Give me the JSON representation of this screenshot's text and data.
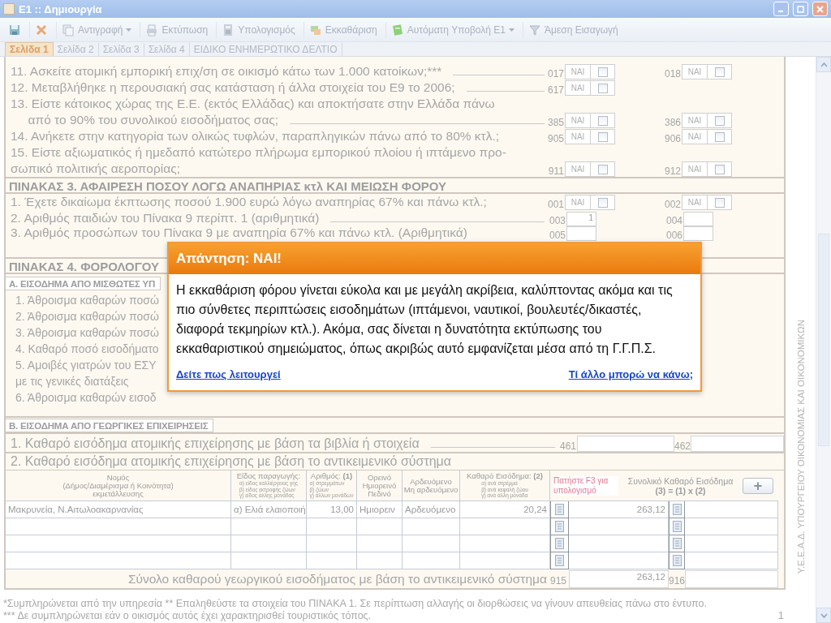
{
  "window": {
    "title": "Ε1 :: Δημιουργία"
  },
  "toolbar": [
    {
      "kind": "save"
    },
    {
      "kind": "delete"
    },
    {
      "kind": "copy",
      "label": "Αντιγραφή",
      "dropdown": true
    },
    {
      "kind": "print",
      "label": "Εκτύπωση",
      "dropdown": false
    },
    {
      "kind": "calc",
      "label": "Υπολογισμός",
      "dropdown": false
    },
    {
      "kind": "clear",
      "label": "Εκκαθάριση",
      "dropdown": false
    },
    {
      "kind": "submit",
      "label": "Αυτόματη Υποβολή Ε1",
      "dropdown": true
    },
    {
      "kind": "import",
      "label": "Άμεση Εισαγωγή",
      "dropdown": false
    }
  ],
  "tabs": [
    {
      "label": "Σελίδα 1",
      "selected": true
    },
    {
      "label": "Σελίδα 2",
      "selected": false
    },
    {
      "label": "Σελίδα 3",
      "selected": false
    },
    {
      "label": "Σελίδα 4",
      "selected": false
    },
    {
      "label": "ΕΙΔΙΚΟ ΕΝΗΜΕΡΩΤΙΚΟ ΔΕΛΤΙΟ",
      "selected": false
    }
  ],
  "questions": [
    {
      "lines": [
        "11. Ασκείτε ατομική εμπορική επιχ/ση σε οικισμό κάτω των 1.000 κατοίκων;***"
      ],
      "leader": true,
      "fields": [
        {
          "kind": "yes",
          "code": "017",
          "label": "ΝΑΙ",
          "checked": false
        },
        {
          "kind": "yes",
          "code": "018",
          "label": "ΝΑΙ",
          "checked": false
        }
      ]
    },
    {
      "lines": [
        "12. Μεταβλήθηκε η περουσιακή σας κατάσταση ή άλλα στοιχεία του Ε9 το 2006;"
      ],
      "leader": true,
      "fields": [
        {
          "kind": "yes",
          "code": "617",
          "label": "ΝΑΙ",
          "checked": false
        }
      ]
    },
    {
      "lines": [
        "13. Είστε κάτοικος χώρας της Ε.Ε. (εκτός Ελλάδας) και αποκτήσατε στην Ελλάδα πάνω",
        "     από το 90% του συνολικού εισοδήματος σας;"
      ],
      "leader": true,
      "fields": [
        {
          "kind": "yes",
          "code": "385",
          "label": "ΝΑΙ",
          "checked": false
        },
        {
          "kind": "yes",
          "code": "386",
          "label": "ΝΑΙ",
          "checked": false
        }
      ]
    },
    {
      "lines": [
        "14. Ανήκετε στην κατηγορία των ολικώς τυφλών, παραπληγικών πάνω από το 80% κτλ.;"
      ],
      "leader": false,
      "fields": [
        {
          "kind": "yes",
          "code": "905",
          "label": "ΝΑΙ",
          "checked": false
        },
        {
          "kind": "yes",
          "code": "906",
          "label": "ΝΑΙ",
          "checked": false
        }
      ]
    },
    {
      "lines": [
        "15. Είστε αξιωματικός ή ημεδαπό κατώτερο πλήρωμα εμπορικού πλοίου ή ιπτάμενο προ-",
        "σωπικό πολιτικής αεροπορίας;"
      ],
      "leader": false,
      "fields": [
        {
          "kind": "yes",
          "code": "911",
          "label": "ΝΑΙ",
          "checked": false
        },
        {
          "kind": "yes",
          "code": "912",
          "label": "ΝΑΙ",
          "checked": false
        }
      ]
    }
  ],
  "table3": {
    "title": "ΠΙΝΑΚΑΣ 3. ΑΦΑΙΡΕΣΗ ΠΟΣΟΥ ΛΟΓΩ ΑΝΑΠΗΡΙΑΣ κτλ ΚΑΙ ΜΕΙΩΣΗ ΦΟΡΟΥ",
    "questions": [
      {
        "lines": [
          "1. Έχετε δικαίωμα έκπτωσης ποσού 1.900 ευρώ λόγω αναπηρίας 67% και πάνω κτλ.;"
        ],
        "leader": false,
        "fields": [
          {
            "kind": "yes",
            "code": "001",
            "label": "ΝΑΙ",
            "checked": false
          },
          {
            "kind": "yes",
            "code": "002",
            "label": "ΝΑΙ",
            "checked": false
          }
        ]
      },
      {
        "lines": [
          "2. Αριθμός παιδιών του Πίνακα 9 περίπτ. 1 (αριθμητικά)"
        ],
        "leader": true,
        "fields": [
          {
            "kind": "number",
            "code": "003",
            "value": "1"
          },
          {
            "kind": "number",
            "code": "004"
          }
        ]
      },
      {
        "lines": [
          "3. Αριθμός προσώπων του Πίνακα 9 με αναπηρία 67% και πάνω κτλ. (Αριθμητικά)"
        ],
        "leader": false,
        "fields": [
          {
            "kind": "number",
            "code": "005"
          },
          {
            "kind": "number",
            "code": "006"
          }
        ]
      }
    ]
  },
  "table4": {
    "title": "ΠΙΝΑΚΑΣ 4. ΦΟΡΟΛΟΓΟΥ",
    "section": "Α. ΕΙΣΟΔΗΜΑ ΑΠΟ ΜΙΣΘΩΤΕΣ ΥΠ",
    "items": [
      {
        "lines": [
          "1. Άθροισμα καθαρών ποσώ"
        ]
      },
      {
        "lines": [
          "2. Άθροισμα καθαρών ποσώ"
        ]
      },
      {
        "lines": [
          "3. Άθροισμα καθαρών ποσώ"
        ]
      },
      {
        "lines": [
          "4. Καθαρό ποσό εισοδήματο"
        ]
      },
      {
        "lines": [
          "5. Αμοιβές γιατρών του ΕΣΥ",
          "με τις γενικές διατάξεις"
        ]
      },
      {
        "lines": [
          "6. Άθροισμα καθαρών εισοδ"
        ]
      }
    ]
  },
  "sectionB": {
    "title": "Β. ΕΙΣΟΔΗΜΑ ΑΠΟ ΓΕΩΡΓΙΚΕΣ ΕΠΙΧΕΙΡΗΣΕΙΣ",
    "row1": {
      "text": "1. Καθαρό εισόδημα ατομικής επιχείρησης με βάση τα βιβλία ή στοιχεία",
      "codes": [
        "461",
        "462"
      ]
    },
    "row2": {
      "text": "2. Καθαρό εισόδημα ατομικής επιχείρησης με βάση το αντικειμενικό σύστημα"
    }
  },
  "farm_table": {
    "columns": [
      {
        "title": "Νομός\n(Δήμος/Διαμέρισμα ή Κοινότητα)\nεκμετάλλευσης"
      },
      {
        "title": "Είδος παραγωγής:",
        "sub": "α) είδος καλλιέργειας γης\nβ) είδος εκτροφής ζώων\nγ) είδος άλλης μονάδας"
      },
      {
        "title": "Αριθμός: **(1)**",
        "sub": "α) στρεμμάτων\nβ) ζώων\nγ) άλλων μονάδων"
      },
      {
        "title": "Ορεινό\nΗμιορεινό\nΠεδινό"
      },
      {
        "title": "Αρδευόμενο\nΜη αρδευόμενο"
      },
      {
        "title": "Καθαρό Εισόδημα: **(2)**",
        "sub": "α) ανά στρέμμα\nβ) ανά κεφαλή ζώου\nγ) ανά άλλη μονάδα"
      }
    ],
    "hint": "Πατήστε F3 για υπολογισμό",
    "total_header": "Συνολικό  Καθαρό Εισόδημα",
    "formula": "(3) = (1) x (2)",
    "add_button": "+",
    "rows": [
      {
        "cells": [
          "Μακρυνεία, Ν.Αιτωλοακαρνανίας",
          "α) Ελιά ελαιοποιή",
          "13,00",
          "Ημιορειν",
          "Αρδευόμενο",
          "20,24"
        ],
        "total": "263,12"
      }
    ],
    "sum": {
      "label": "Σύνολο καθαρού γεωργικού εισοδήματος με βάση το αντικειμενικό σύστημα",
      "code": "915",
      "value": "263,12",
      "code2": "916"
    }
  },
  "footnotes": [
    "*Συμπληρώνεται από την υπηρεσία  ** Επαληθεύστε τα στοιχεία του ΠΙΝΑΚΑ 1. Σε περίπτωση αλλαγής οι διορθώσεις να γίνουν απευθείας πάνω στο έντυπο.",
    "*** Δε συμπληρώνεται εάν ο οικισμός αυτός έχει χαρακτηρισθεί τουριστικός τόπος."
  ],
  "page_number": "1",
  "side_text": "Υ.Ε.Ε.Α.Δ. ΥΠΟΥΡΓΕΙΟΥ ΟΙΚΟΝΟΜΙΑΣ ΚΑΙ ΟΙΚΟΝΟΜΙΚΩΝ",
  "popup": {
    "title": "Απάντηση: ΝΑΙ!",
    "body": "Η εκκαθάριση φόρου γίνεται εύκολα και με μεγάλη ακρίβεια, καλύπτοντας ακόμα και τις πιο σύνθετες περιπτώσεις εισοδημάτων (ιπτάμενοι, ναυτικοί, βουλευτές/δικαστές, διαφορά τεκμηρίων κτλ.). Ακόμα, σας δίνεται η δυνατότητα εκτύπωσης του εκκαθαριστικού σημειώματος, όπως ακριβώς αυτό εμφανίζεται μέσα από τη Γ.Γ.Π.Σ.",
    "links": [
      "Δείτε πως λειτουργεί",
      "Τί άλλο μπορώ να κάνω;"
    ]
  }
}
